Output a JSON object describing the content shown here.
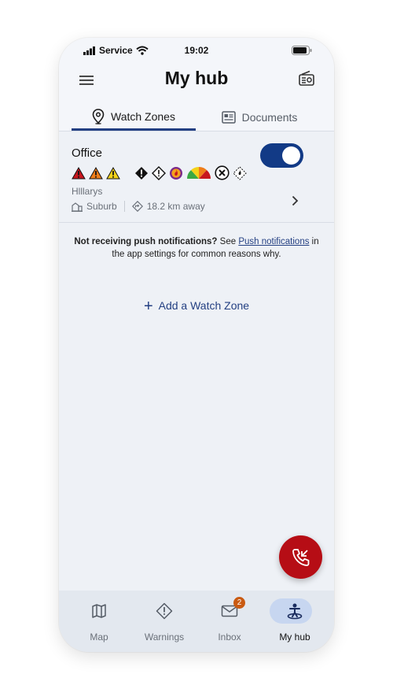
{
  "status_bar": {
    "carrier": "Service",
    "time": "19:02"
  },
  "header": {
    "title": "My hub"
  },
  "tabs": [
    {
      "label": "Watch Zones",
      "icon": "map-pin-icon",
      "active": true
    },
    {
      "label": "Documents",
      "icon": "document-icon",
      "active": false
    }
  ],
  "zone": {
    "name": "Office",
    "enabled": true,
    "suburb_name": "Hlllarys",
    "type_label": "Suburb",
    "distance": "18.2 km away",
    "warning_icons": [
      "red-warning-triangle-icon",
      "orange-warning-triangle-icon",
      "yellow-warning-triangle-icon",
      "black-diamond-alert-icon",
      "outline-diamond-alert-icon",
      "fire-danger-circle-icon",
      "fire-danger-rating-gauge-icon",
      "cross-circle-icon",
      "burn-diamond-icon"
    ]
  },
  "push_notice": {
    "bold_text": "Not receiving push notifications?",
    "pre_link": " See ",
    "link_text": "Push notifications",
    "post_link": " in the app settings for common reasons why."
  },
  "add_zone_label": "Add a Watch Zone",
  "bottom_nav": [
    {
      "label": "Map",
      "icon": "map-icon"
    },
    {
      "label": "Warnings",
      "icon": "warning-diamond-icon"
    },
    {
      "label": "Inbox",
      "icon": "mail-icon",
      "badge": "2"
    },
    {
      "label": "My hub",
      "icon": "person-hub-icon",
      "active": true
    }
  ],
  "colors": {
    "accent": "#123a86",
    "emergency": "#b60d15",
    "badge": "#c95a12"
  }
}
